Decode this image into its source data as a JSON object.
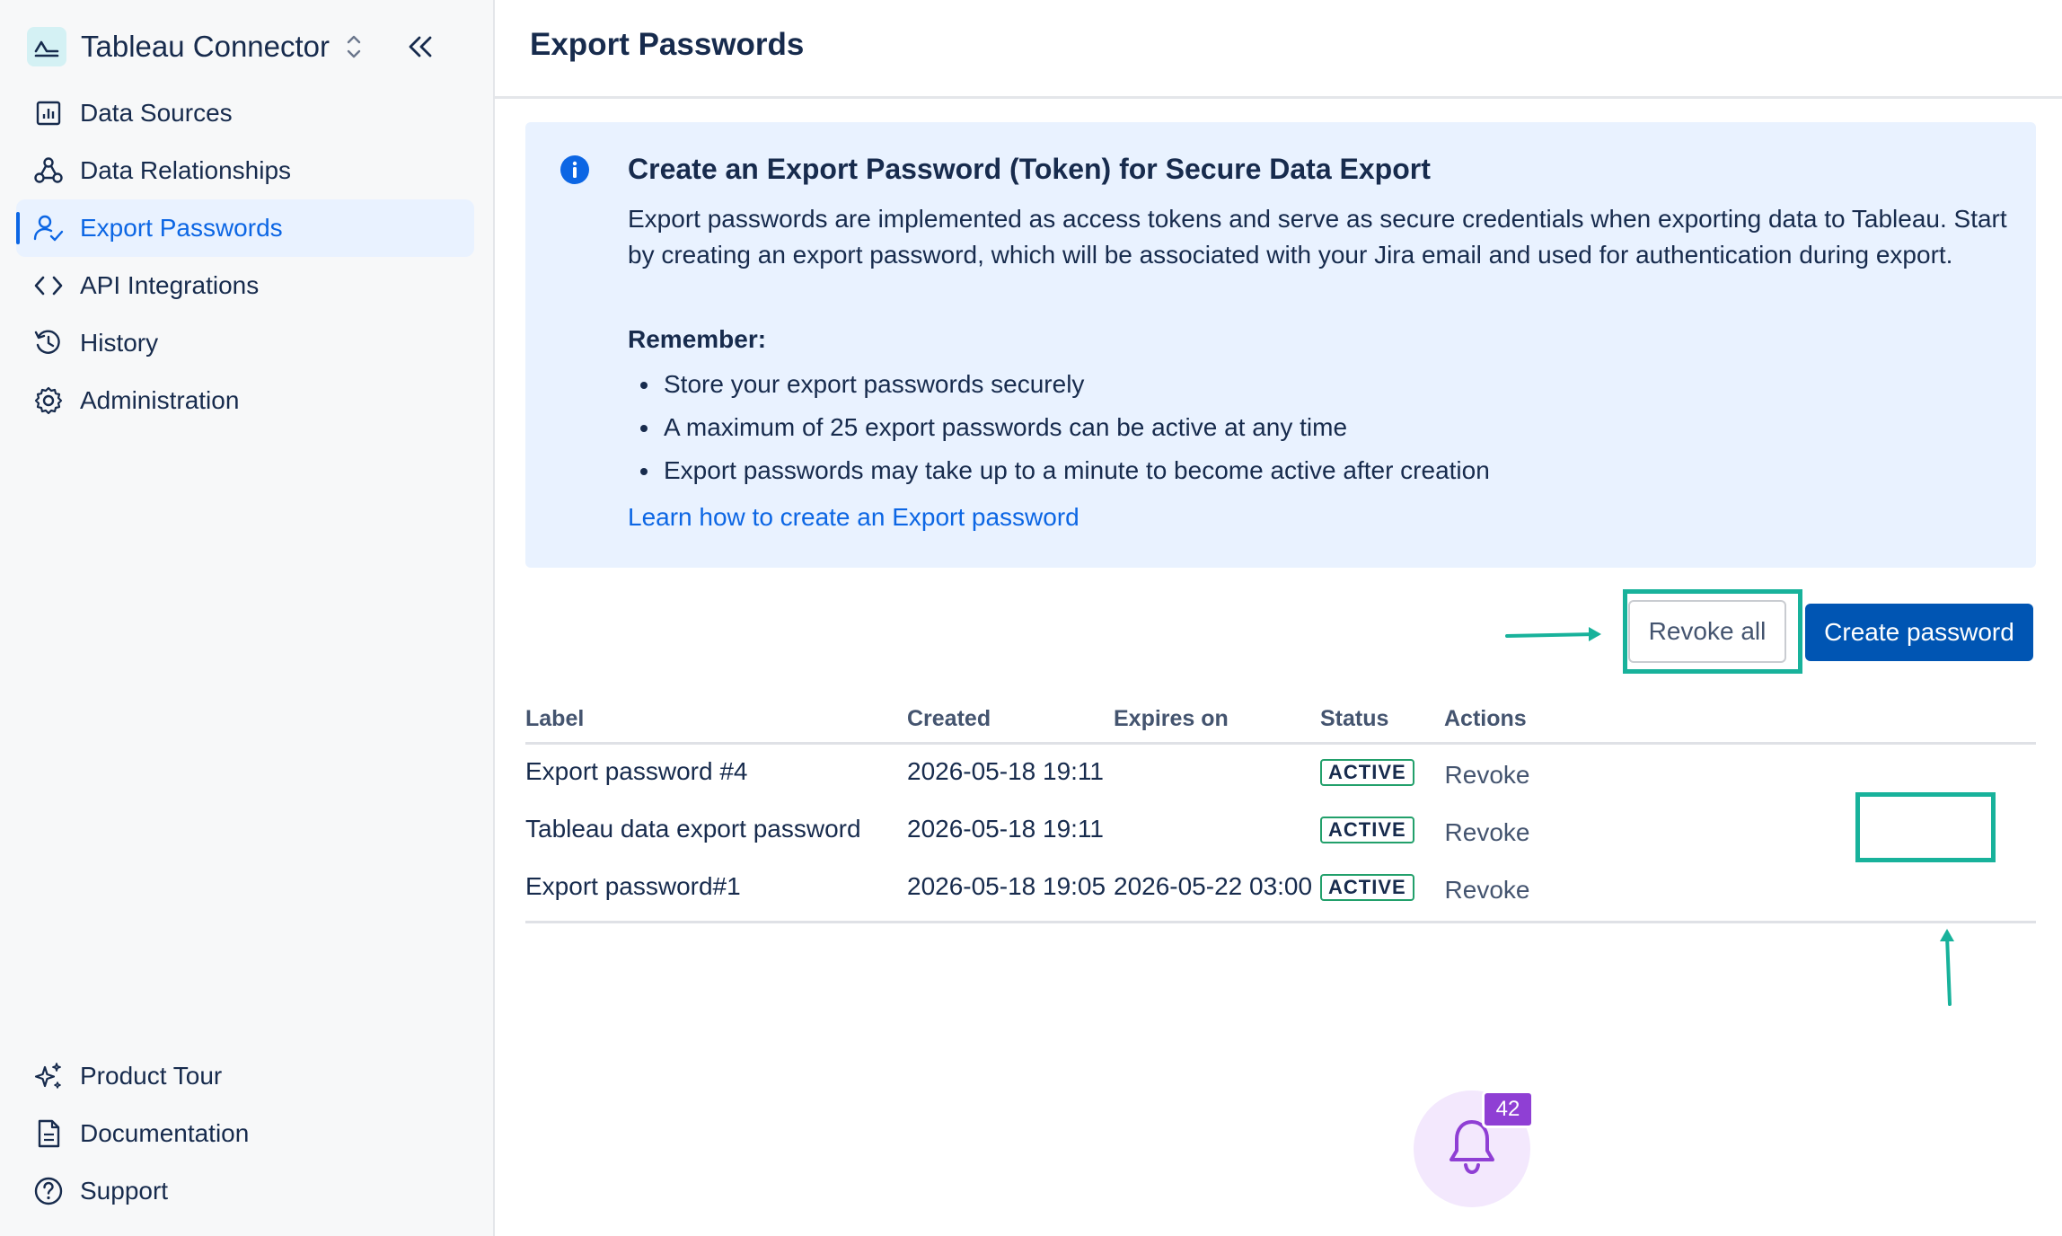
{
  "app": {
    "title": "Tableau Connector",
    "logo_icon": "tableau-connector-logo-icon",
    "switch_icon": "chevron-up-down-icon",
    "collapse_icon": "double-chevron-left-icon"
  },
  "sidebar": {
    "items": [
      {
        "label": "Data Sources",
        "icon": "bar-chart-icon",
        "active": false
      },
      {
        "label": "Data Relationships",
        "icon": "relationships-icon",
        "active": false
      },
      {
        "label": "Export Passwords",
        "icon": "user-check-icon",
        "active": true
      },
      {
        "label": "API Integrations",
        "icon": "code-icon",
        "active": false
      },
      {
        "label": "History",
        "icon": "history-icon",
        "active": false
      },
      {
        "label": "Administration",
        "icon": "gear-icon",
        "active": false
      }
    ],
    "footer_items": [
      {
        "label": "Product Tour",
        "icon": "sparkle-icon"
      },
      {
        "label": "Documentation",
        "icon": "document-icon"
      },
      {
        "label": "Support",
        "icon": "help-circle-icon"
      }
    ]
  },
  "page": {
    "title": "Export Passwords"
  },
  "info": {
    "title": "Create an Export Password (Token) for Secure Data Export",
    "description": "Export passwords are implemented as access tokens and serve as secure credentials when exporting data to Tableau. Start by creating an export password, which will be associated with your Jira email and used for authentication during export.",
    "remember_title": "Remember:",
    "bullets": [
      "Store your export passwords securely",
      "A maximum of 25 export passwords can be active at any time",
      "Export passwords may take up to a minute to become active after creation"
    ],
    "link": "Learn how to create an Export password"
  },
  "actions": {
    "revoke_all": "Revoke all",
    "create": "Create password"
  },
  "table": {
    "headers": [
      "Label",
      "Created",
      "Expires on",
      "Status",
      "Actions"
    ],
    "rows": [
      {
        "label": "Export password #4",
        "created": "2026-05-18 19:11",
        "expires": "",
        "status": "ACTIVE",
        "action": "Revoke"
      },
      {
        "label": "Tableau data export password",
        "created": "2026-05-18 19:11",
        "expires": "",
        "status": "ACTIVE",
        "action": "Revoke"
      },
      {
        "label": "Export password#1",
        "created": "2026-05-18 19:05",
        "expires": "2026-05-22 03:00",
        "status": "ACTIVE",
        "action": "Revoke"
      }
    ]
  },
  "notifications": {
    "count": "42",
    "icon": "bell-icon"
  },
  "colors": {
    "accent": "#0c66e4",
    "primary_button": "#0055b3",
    "info_background": "#e9f2ff",
    "highlight": "#18b29b",
    "status_active": "#22a06b",
    "notification": "#8f3fd4"
  }
}
